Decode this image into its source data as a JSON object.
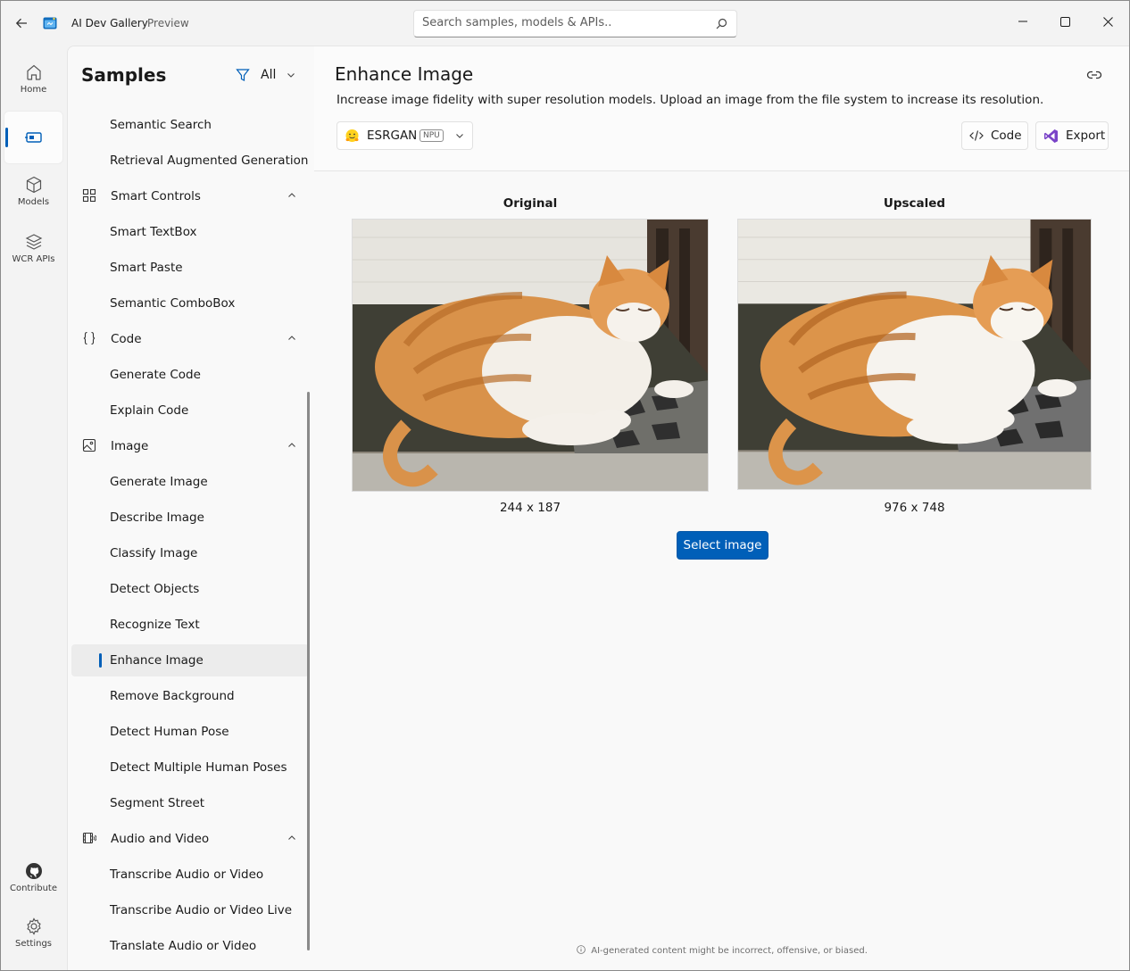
{
  "titlebar": {
    "title": "AI Dev Gallery",
    "subtitle": "Preview",
    "search_placeholder": "Search samples, models & APIs.."
  },
  "rail": {
    "items": [
      {
        "label": "Home",
        "icon": "home-icon"
      },
      {
        "label": "",
        "icon": "samples-icon",
        "active": true
      },
      {
        "label": "Models",
        "icon": "cube-icon"
      },
      {
        "label": "WCR APIs",
        "icon": "layers-icon"
      },
      {
        "label": "Contribute",
        "icon": "github-icon"
      },
      {
        "label": "Settings",
        "icon": "gear-icon"
      }
    ]
  },
  "samples": {
    "title": "Samples",
    "filter_label": "All",
    "tree": [
      {
        "label": "Semantic Search",
        "type": "child"
      },
      {
        "label": "Retrieval Augmented Generation",
        "type": "child"
      },
      {
        "label": "Smart Controls",
        "type": "group",
        "icon": "smart-controls-icon"
      },
      {
        "label": "Smart TextBox",
        "type": "child"
      },
      {
        "label": "Smart Paste",
        "type": "child"
      },
      {
        "label": "Semantic ComboBox",
        "type": "child"
      },
      {
        "label": "Code",
        "type": "group",
        "icon": "braces-icon"
      },
      {
        "label": "Generate Code",
        "type": "child"
      },
      {
        "label": "Explain Code",
        "type": "child"
      },
      {
        "label": "Image",
        "type": "group",
        "icon": "image-icon"
      },
      {
        "label": "Generate Image",
        "type": "child"
      },
      {
        "label": "Describe Image",
        "type": "child"
      },
      {
        "label": "Classify Image",
        "type": "child"
      },
      {
        "label": "Detect Objects",
        "type": "child"
      },
      {
        "label": "Recognize Text",
        "type": "child"
      },
      {
        "label": "Enhance Image",
        "type": "child",
        "selected": true
      },
      {
        "label": "Remove Background",
        "type": "child"
      },
      {
        "label": "Detect Human Pose",
        "type": "child"
      },
      {
        "label": "Detect Multiple Human Poses",
        "type": "child"
      },
      {
        "label": "Segment Street",
        "type": "child"
      },
      {
        "label": "Audio and Video",
        "type": "group",
        "icon": "audio-video-icon"
      },
      {
        "label": "Transcribe Audio or Video",
        "type": "child"
      },
      {
        "label": "Transcribe Audio or Video Live",
        "type": "child"
      },
      {
        "label": "Translate Audio or Video",
        "type": "child"
      }
    ]
  },
  "main": {
    "title": "Enhance Image",
    "description": "Increase image fidelity with super resolution models. Upload an image from the file system to increase its resolution.",
    "model": {
      "name": "ESRGAN",
      "badge": "NPU"
    },
    "code_label": "Code",
    "export_label": "Export",
    "original": {
      "title": "Original",
      "size": "244 x 187"
    },
    "upscaled": {
      "title": "Upscaled",
      "size": "976 x 748"
    },
    "select_label": "Select image",
    "disclaimer": "AI-generated content might be incorrect, offensive, or biased."
  },
  "colors": {
    "accent": "#005fb8"
  }
}
